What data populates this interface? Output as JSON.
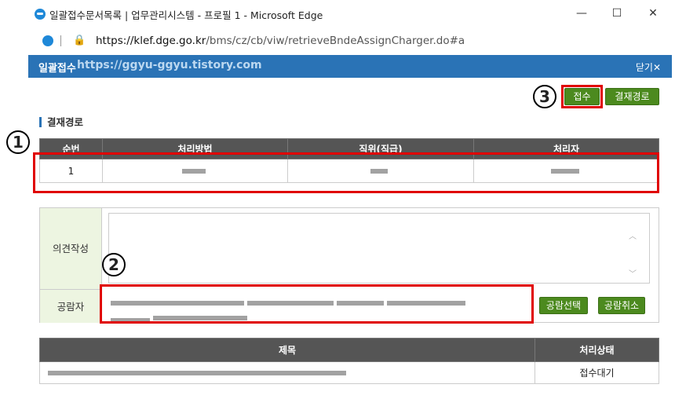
{
  "window": {
    "title": "일괄접수문서목록 | 업무관리시스템 - 프로필 1 - Microsoft Edge",
    "minimize": "—",
    "maximize": "☐",
    "close": "✕"
  },
  "address": {
    "url_host": "https://klef.dge.go.kr",
    "url_path": "/bms/cz/cb/viw/retrieveBndeAssignCharger.do#a"
  },
  "popup": {
    "title": "일괄접수",
    "watermark": "https://ggyu-ggyu.tistory.com",
    "close_label": "닫기✕"
  },
  "toolbar": {
    "receive_label": "접수",
    "approval_path_label": "결재경로"
  },
  "section": {
    "title": "결재경로"
  },
  "approval_table": {
    "headers": [
      "순번",
      "처리방법",
      "직위(직급)",
      "처리자"
    ],
    "rows": [
      {
        "no": "1",
        "method": "",
        "position": "",
        "handler": ""
      }
    ]
  },
  "opinion": {
    "label": "의견작성",
    "value": ""
  },
  "viewers": {
    "label": "공람자",
    "select_label": "공람선택",
    "cancel_label": "공람취소"
  },
  "doc_table": {
    "headers": [
      "제목",
      "처리상태"
    ],
    "rows": [
      {
        "title": "",
        "status": "접수대기"
      }
    ]
  },
  "annotations": {
    "one": "1",
    "two": "2",
    "three": "3"
  },
  "colors": {
    "header_blue": "#2a73b6",
    "button_green": "#4c8a1e",
    "highlight_red": "#e00000",
    "label_bg": "#edf5e1"
  }
}
